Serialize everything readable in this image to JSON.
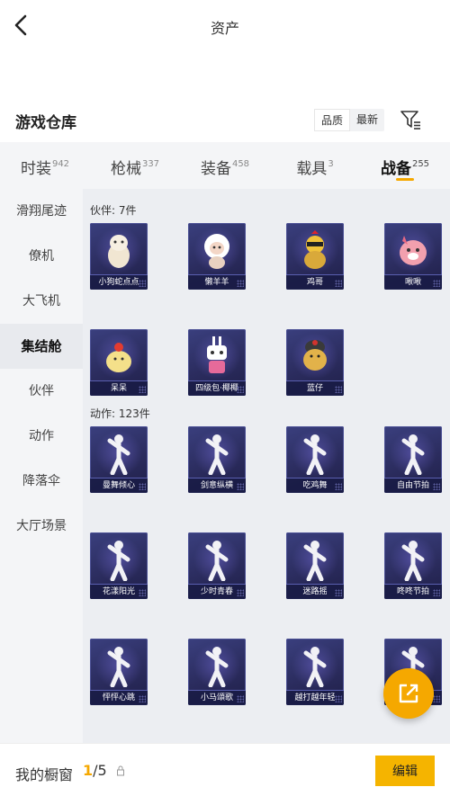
{
  "header": {
    "title": "资产"
  },
  "section": {
    "title": "游戏仓库",
    "sort_options": [
      "品质",
      "最新"
    ],
    "active_sort": 0
  },
  "tabs": [
    {
      "label": "时装",
      "count": "942"
    },
    {
      "label": "枪械",
      "count": "337"
    },
    {
      "label": "装备",
      "count": "458"
    },
    {
      "label": "载具",
      "count": "3"
    },
    {
      "label": "战备",
      "count": "255",
      "active": true
    }
  ],
  "sidebar": {
    "items": [
      "滑翔尾迹",
      "僚机",
      "大飞机",
      "集结舱",
      "伙伴",
      "动作",
      "降落伞",
      "大厅场景"
    ],
    "active_index": 3
  },
  "groups": [
    {
      "label": "伙伴: 7件",
      "items": [
        "小狗蛇点点",
        "懒羊羊",
        "鸡哥",
        "啾啾",
        "呆呆",
        "四级包·椰椰",
        "蓝仔"
      ]
    },
    {
      "label": "动作: 123件",
      "items": [
        "曼舞倾心",
        "剑意纵横",
        "吃鸡舞",
        "自由节拍",
        "花漾阳光",
        "少时青春",
        "迷路摇",
        "咚咚节拍",
        "怦怦心跳",
        "小马頌歌",
        "越打越年轻",
        ""
      ]
    }
  ],
  "bottom": {
    "label": "我的橱窗",
    "current": "1",
    "total": "/5",
    "edit_label": "编辑"
  },
  "colors": {
    "accent": "#f5a800",
    "card_bg": "#2b2c5e"
  },
  "icons": {
    "back": "chevron-left-icon",
    "filter": "filter-icon",
    "share": "share-edit-icon",
    "lock": "lock-icon"
  }
}
